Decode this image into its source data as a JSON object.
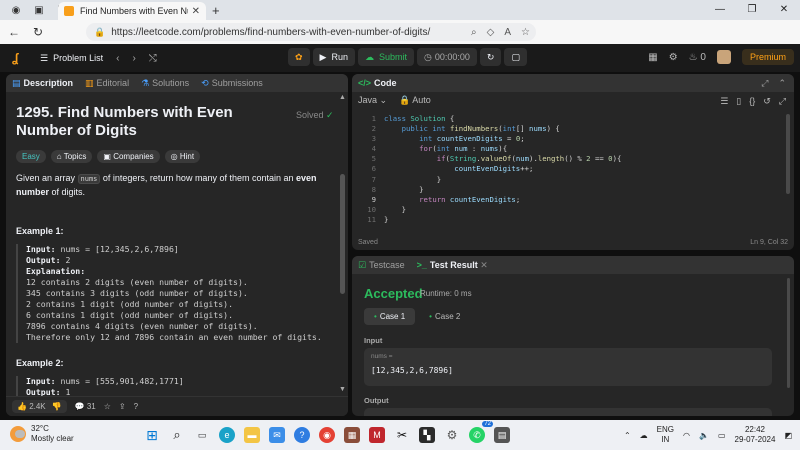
{
  "browser": {
    "tab_title": "Find Numbers with Even Numbe",
    "url": "https://leetcode.com/problems/find-numbers-with-even-number-of-digits/"
  },
  "nav": {
    "problem_list": "Problem List",
    "run": "Run",
    "submit": "Submit",
    "timer": "00:00:00",
    "notifications": "0",
    "premium": "Premium"
  },
  "left_panel": {
    "tabs": [
      "Description",
      "Editorial",
      "Solutions",
      "Submissions"
    ],
    "title": "1295. Find Numbers with Even Number of Digits",
    "solved": "Solved",
    "tags": [
      "Easy",
      "Topics",
      "Companies",
      "Hint"
    ],
    "statement": {
      "before": "Given an array ",
      "code": "nums",
      "middle": " of integers, return how many of them contain an ",
      "bold": "even number",
      "after": " of digits."
    },
    "example1": {
      "heading": "Example 1:",
      "input_label": "Input:",
      "input": "nums = [12,345,2,6,7896]",
      "output_label": "Output:",
      "output": "2",
      "explanation_label": "Explanation:",
      "lines": [
        "12 contains 2 digits (even number of digits).",
        "345 contains 3 digits (odd number of digits).",
        "2 contains 1 digit (odd number of digits).",
        "6 contains 1 digit (odd number of digits).",
        "7896 contains 4 digits (even number of digits).",
        "Therefore only 12 and 7896 contain an even number of digits."
      ]
    },
    "example2": {
      "heading": "Example 2:",
      "input_label": "Input:",
      "input": "nums = [555,901,482,1771]",
      "output_label": "Output:",
      "output": "1"
    },
    "footer": {
      "likes": "2.4K",
      "comments": "31"
    }
  },
  "code_panel": {
    "title": "Code",
    "language": "Java",
    "mode": "Auto",
    "status_left": "Saved",
    "status_right": "Ln 9, Col 32",
    "line_numbers": [
      "1",
      "2",
      "3",
      "4",
      "5",
      "6",
      "7",
      "8",
      "9",
      "10",
      "11"
    ]
  },
  "result_panel": {
    "tabs": [
      "Testcase",
      "Test Result"
    ],
    "verdict": "Accepted",
    "runtime": "Runtime: 0 ms",
    "cases": [
      "Case 1",
      "Case 2"
    ],
    "input_label": "Input",
    "input_name": "nums =",
    "input_value": "[12,345,2,6,7896]",
    "output_label": "Output"
  },
  "taskbar": {
    "temp": "32°C",
    "weather": "Mostly clear",
    "badge": "72",
    "lang1": "ENG",
    "lang2": "IN",
    "time": "22:42",
    "date": "29-07-2024"
  },
  "colors": {
    "accent_green": "#2cbb5d",
    "brand_orange": "#ffa116",
    "panel_bg": "#262626"
  }
}
